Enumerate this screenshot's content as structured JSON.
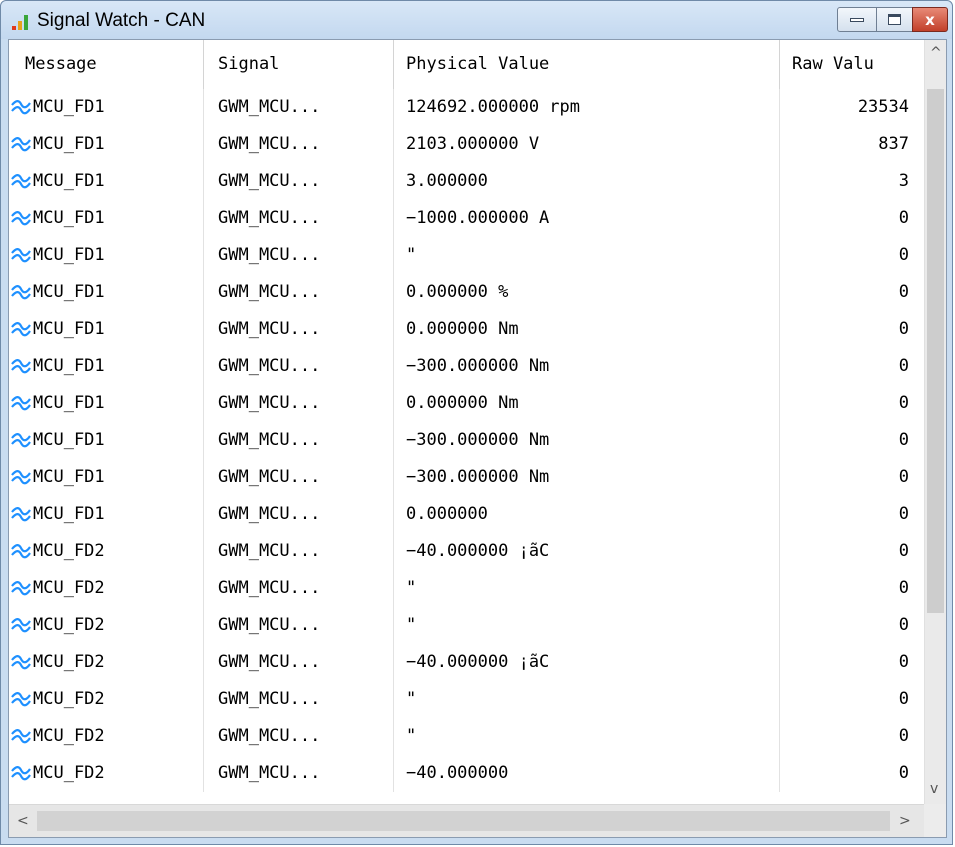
{
  "window": {
    "title": "Signal Watch - CAN",
    "buttons": {
      "minimize": "minimize",
      "maximize": "maximize",
      "close": "x"
    }
  },
  "table": {
    "columns": [
      "Message",
      "Signal",
      "Physical Value",
      "Raw Valu"
    ],
    "rows": [
      {
        "message": "MCU_FD1",
        "signal": "GWM_MCU...",
        "physical": "124692.000000 rpm",
        "raw": "23534"
      },
      {
        "message": "MCU_FD1",
        "signal": "GWM_MCU...",
        "physical": "2103.000000 V",
        "raw": "837"
      },
      {
        "message": "MCU_FD1",
        "signal": "GWM_MCU...",
        "physical": "3.000000",
        "raw": "3"
      },
      {
        "message": "MCU_FD1",
        "signal": "GWM_MCU...",
        "physical": "−1000.000000 A",
        "raw": "0"
      },
      {
        "message": "MCU_FD1",
        "signal": "GWM_MCU...",
        "physical": "\"",
        "raw": "0"
      },
      {
        "message": "MCU_FD1",
        "signal": "GWM_MCU...",
        "physical": "0.000000 %",
        "raw": "0"
      },
      {
        "message": "MCU_FD1",
        "signal": "GWM_MCU...",
        "physical": "0.000000 Nm",
        "raw": "0"
      },
      {
        "message": "MCU_FD1",
        "signal": "GWM_MCU...",
        "physical": "−300.000000 Nm",
        "raw": "0"
      },
      {
        "message": "MCU_FD1",
        "signal": "GWM_MCU...",
        "physical": "0.000000 Nm",
        "raw": "0"
      },
      {
        "message": "MCU_FD1",
        "signal": "GWM_MCU...",
        "physical": "−300.000000 Nm",
        "raw": "0"
      },
      {
        "message": "MCU_FD1",
        "signal": "GWM_MCU...",
        "physical": "−300.000000 Nm",
        "raw": "0"
      },
      {
        "message": "MCU_FD1",
        "signal": "GWM_MCU...",
        "physical": "0.000000",
        "raw": "0"
      },
      {
        "message": "MCU_FD2",
        "signal": "GWM_MCU...",
        "physical": "−40.000000 ¡ãC",
        "raw": "0"
      },
      {
        "message": "MCU_FD2",
        "signal": "GWM_MCU...",
        "physical": "\"",
        "raw": "0"
      },
      {
        "message": "MCU_FD2",
        "signal": "GWM_MCU...",
        "physical": "\"",
        "raw": "0"
      },
      {
        "message": "MCU_FD2",
        "signal": "GWM_MCU...",
        "physical": "−40.000000 ¡ãC",
        "raw": "0"
      },
      {
        "message": "MCU_FD2",
        "signal": "GWM_MCU...",
        "physical": "\"",
        "raw": "0"
      },
      {
        "message": "MCU_FD2",
        "signal": "GWM_MCU...",
        "physical": "\"",
        "raw": "0"
      },
      {
        "message": "MCU_FD2",
        "signal": "GWM_MCU...",
        "physical": "−40.000000",
        "raw": "0"
      }
    ]
  },
  "scrollbars": {
    "up": "^",
    "down": "v",
    "left": "<",
    "right": ">"
  },
  "colors": {
    "signal_icon": "#1e90ff",
    "title_bg": "#c9dcf0",
    "close_button": "#c8452e"
  },
  "icons": {
    "app": "signal-bars-icon",
    "signal": "waveform-icon"
  }
}
